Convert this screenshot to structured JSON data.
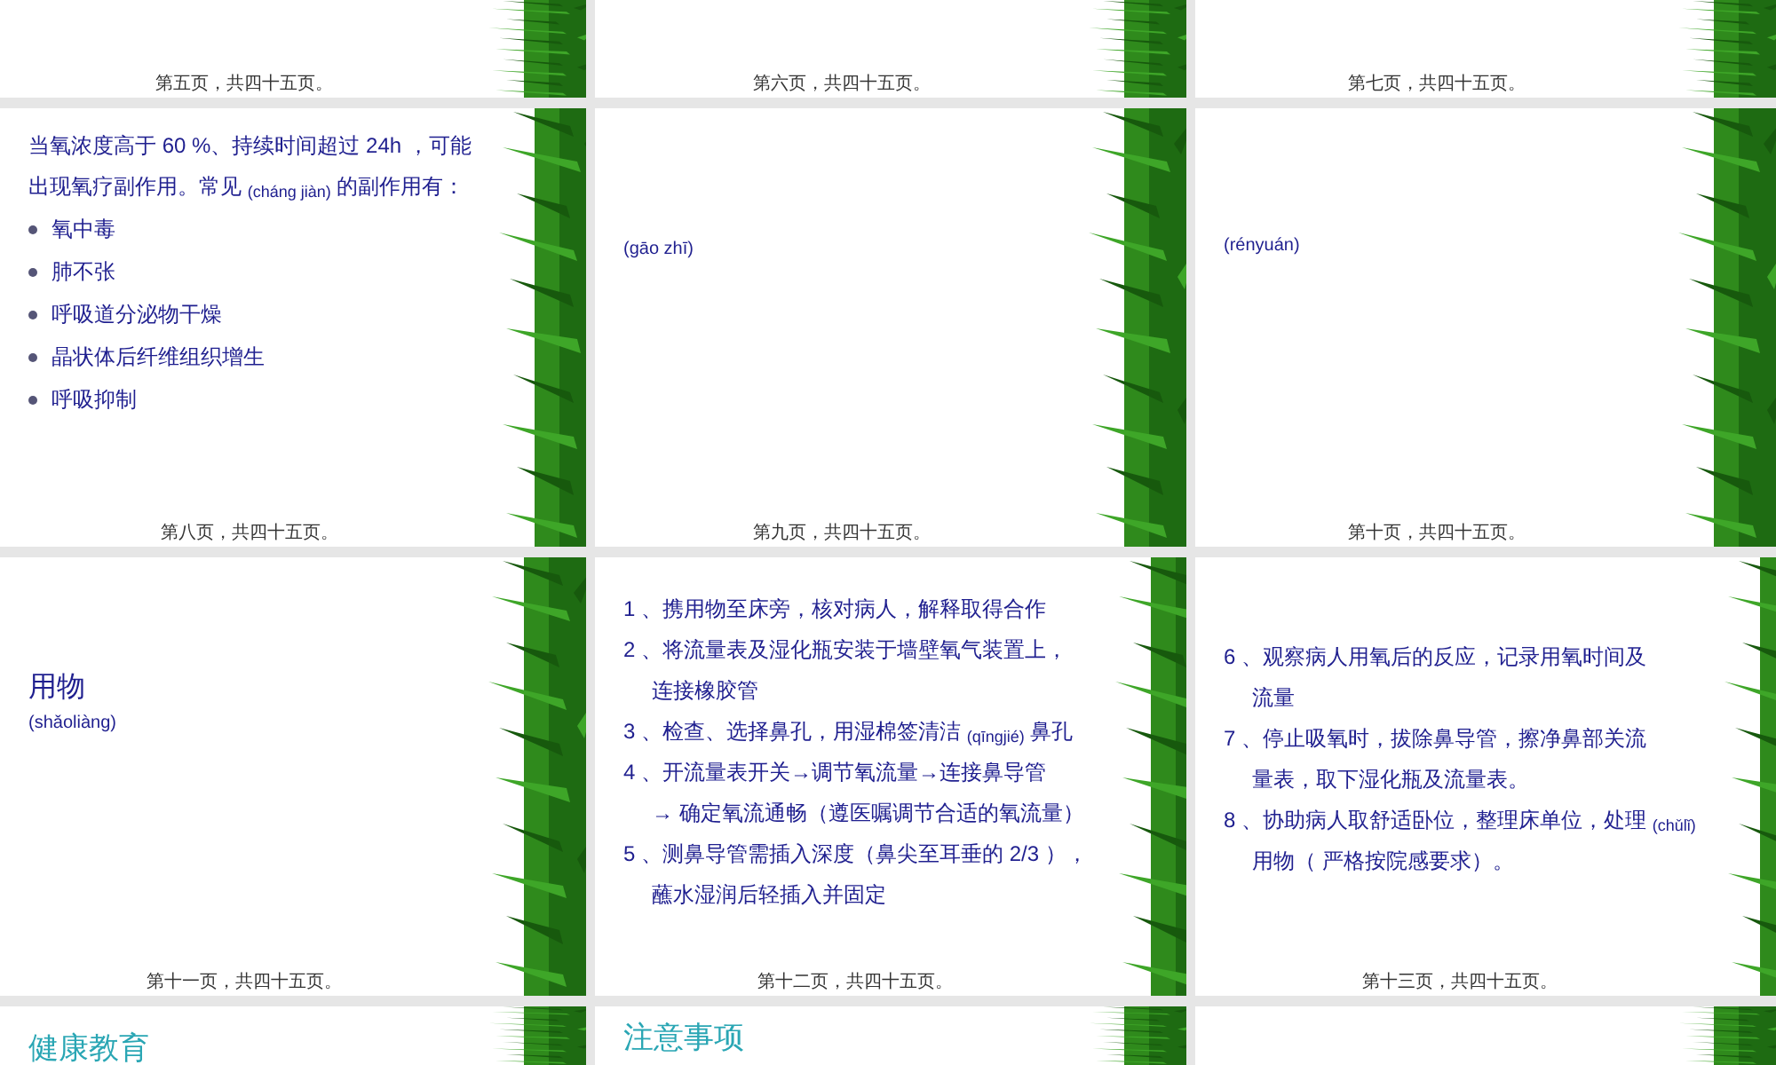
{
  "slides": [
    {
      "footer": "第五页，共四十五页。"
    },
    {
      "footer": "第六页，共四十五页。"
    },
    {
      "footer": "第七页，共四十五页。"
    },
    {
      "footer": "第八页，共四十五页。",
      "blocks": [
        {
          "kind": "line",
          "text": "当氧浓度高于 60 %、持续时间超过 24h ，可能"
        },
        {
          "kind": "line",
          "text": "出现氧疗副作用。常见 $_{(cháng jiàn)}$ 的副作用有："
        },
        {
          "kind": "bullet",
          "text": "氧中毒"
        },
        {
          "kind": "bullet",
          "text": "肺不张"
        },
        {
          "kind": "bullet",
          "text": "呼吸道分泌物干燥"
        },
        {
          "kind": "bullet",
          "text": "晶状体后纤维组织增生"
        },
        {
          "kind": "bullet",
          "text": "呼吸抑制"
        }
      ]
    },
    {
      "footer": "第九页，共四十五页。",
      "blocks": [
        {
          "kind": "note",
          "text": "(gāo zhī)"
        }
      ]
    },
    {
      "footer": "第十页，共四十五页。",
      "blocks": [
        {
          "kind": "note",
          "text": "(rényuán)"
        }
      ]
    },
    {
      "footer": "第十一页，共四十五页。",
      "blocks": [
        {
          "kind": "heading",
          "text": "用物"
        },
        {
          "kind": "note",
          "text": "(shǎoliàng)"
        }
      ]
    },
    {
      "footer": "第十二页，共四十五页。",
      "blocks": [
        {
          "kind": "line",
          "text": "1 、携用物至床旁，核对病人，解释取得合作"
        },
        {
          "kind": "line",
          "text": "2 、将流量表及湿化瓶安装于墙壁氧气装置上，"
        },
        {
          "kind": "indent",
          "text": "连接橡胶管"
        },
        {
          "kind": "line",
          "text": "3 、检查、选择鼻孔，用湿棉签清洁 $_{(qīngjié)}$ 鼻孔"
        },
        {
          "kind": "line",
          "text": "4 、开流量表开关→调节氧流量→连接鼻导管"
        },
        {
          "kind": "indent",
          "text": "→ 确定氧流通畅（遵医嘱调节合适的氧流量）"
        },
        {
          "kind": "line",
          "text": "5 、测鼻导管需插入深度（鼻尖至耳垂的 2/3 ），"
        },
        {
          "kind": "indent",
          "text": "蘸水湿润后轻插入并固定"
        }
      ]
    },
    {
      "footer": "第十三页，共四十五页。",
      "blocks": [
        {
          "kind": "line",
          "text": "6 、观察病人用氧后的反应，记录用氧时间及"
        },
        {
          "kind": "indent",
          "text": "流量"
        },
        {
          "kind": "line",
          "text": "7 、停止吸氧时，拔除鼻导管，擦净鼻部关流"
        },
        {
          "kind": "indent",
          "text": "量表，取下湿化瓶及流量表。"
        },
        {
          "kind": "line",
          "text": "8 、协助病人取舒适卧位，整理床单位，处理 $_{(chǔlǐ)}$"
        },
        {
          "kind": "indent",
          "text": "用物（ 严格按院感要求）。"
        }
      ]
    },
    {
      "blocks": [
        {
          "kind": "title",
          "text": "健康教育"
        }
      ]
    },
    {
      "blocks": [
        {
          "kind": "title",
          "text": "注意事项"
        }
      ]
    }
  ]
}
